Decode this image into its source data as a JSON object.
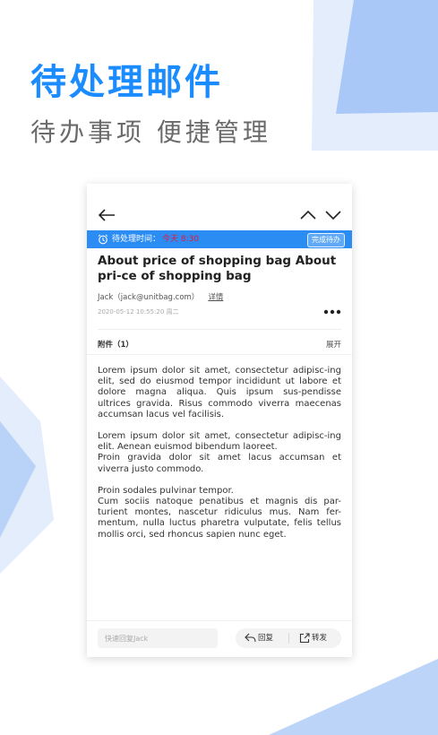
{
  "hero": {
    "title": "待处理邮件",
    "subtitle": "待办事项  便捷管理"
  },
  "colors": {
    "accent": "#2b8cf3",
    "title_blue": "#1a8cff",
    "urgent_red": "#e8183a",
    "shape_light": "#dfeafc",
    "shape_mid": "#a9c8f7"
  },
  "nav": {
    "back_icon": "arrow-left-icon",
    "up_icon": "chevron-up-icon",
    "down_icon": "chevron-down-icon"
  },
  "banner": {
    "label": "待处理时间：",
    "time": "今天  8:30",
    "done_label": "完成待办"
  },
  "email": {
    "subject": "About price of shopping bag About pri-ce of shopping bag",
    "sender": "Jack（jack@unitbag.com）",
    "details_link": "详情",
    "datetime": "2020-05-12 10:55:20   周二",
    "attachments_label": "附件（1）",
    "expand_label": "展开",
    "paragraphs": [
      "Lorem ipsum dolor sit amet, consectetur adipisc-ing elit, sed do eiusmod tempor incididunt ut labore et dolore magna aliqua. Quis ipsum sus-pendisse ultrices gravida. Risus commodo viverra maecenas accumsan lacus vel facilisis.",
      "Lorem ipsum dolor sit amet, consectetur adipisc-ing elit. Aenean euismod bibendum laoreet.",
      "Proin gravida dolor sit amet lacus accumsan et viverra justo commodo.",
      "Proin sodales pulvinar tempor.",
      "Cum sociis natoque penatibus et magnis dis par-turient montes, nascetur ridiculus mus. Nam fer-mentum, nulla luctus pharetra vulputate, felis tellus mollis orci, sed rhoncus sapien nunc eget."
    ]
  },
  "bottom": {
    "quick_reply_placeholder": "快速回复Jack",
    "reply_label": "回复",
    "forward_label": "转发"
  }
}
